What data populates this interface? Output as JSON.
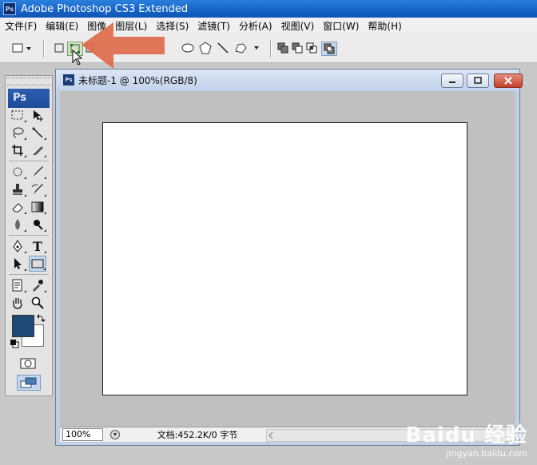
{
  "app": {
    "title": "Adobe Photoshop CS3 Extended",
    "badge": "Ps"
  },
  "menu": [
    {
      "label": "文件(F)"
    },
    {
      "label": "编辑(E)"
    },
    {
      "label": "图像"
    },
    {
      "label": "图层(L)"
    },
    {
      "label": "选择(S)"
    },
    {
      "label": "滤镜(T)"
    },
    {
      "label": "分析(A)"
    },
    {
      "label": "视图(V)"
    },
    {
      "label": "窗口(W)"
    },
    {
      "label": "帮助(H)"
    }
  ],
  "options_bar": {
    "tool_preset_icon": "rectangle-preset-icon",
    "mode_icons": [
      "shape-layers-icon",
      "paths-icon",
      "fill-pixels-icon"
    ],
    "selected_mode": "paths-icon",
    "shape_icons": [
      "ellipse-icon",
      "polygon-icon",
      "line-icon",
      "custom-shape-icon"
    ],
    "combine_icons": [
      "add-icon",
      "subtract-icon",
      "intersect-icon",
      "exclude-icon"
    ]
  },
  "tools_panel": {
    "logo": "Ps",
    "selected_tool": "rectangle-tool",
    "foreground_color": "#1f4a78",
    "background_color": "#ffffff"
  },
  "document": {
    "title": "未标题-1 @ 100%(RGB/8)",
    "zoom": "100%",
    "status": "文档:452.2K/0 字节"
  },
  "overlay": {
    "arrow_color": "#e06a4a"
  },
  "watermark": {
    "logo": "Baidu 经验",
    "url": "jingyan.baidu.com"
  }
}
